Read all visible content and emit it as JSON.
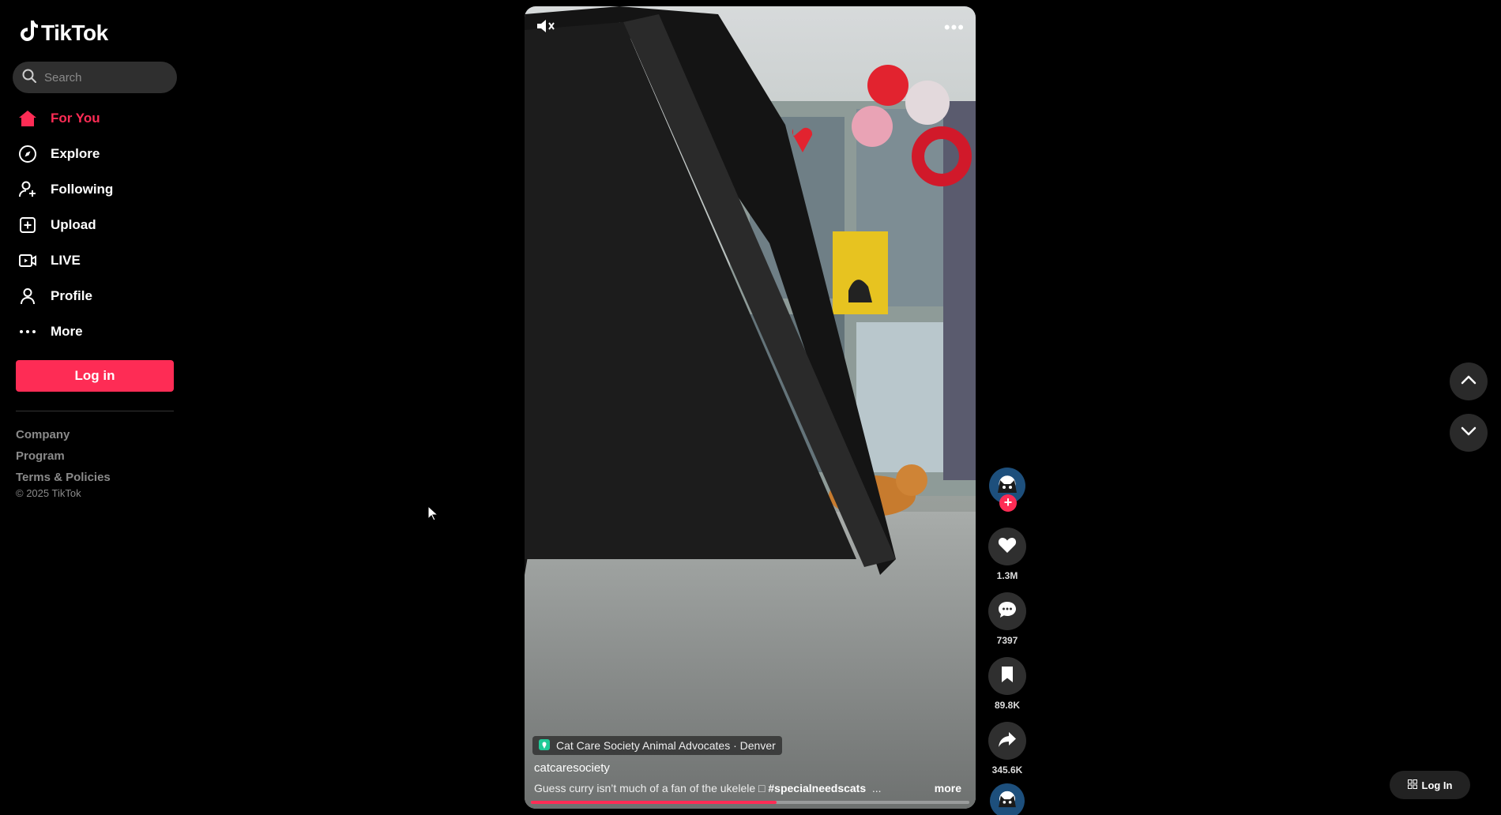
{
  "app": {
    "name": "TikTok"
  },
  "search": {
    "placeholder": "Search"
  },
  "nav": [
    {
      "label": "For You",
      "icon": "home-icon",
      "active": true
    },
    {
      "label": "Explore",
      "icon": "compass-icon"
    },
    {
      "label": "Following",
      "icon": "following-icon"
    },
    {
      "label": "Upload",
      "icon": "upload-icon"
    },
    {
      "label": "LIVE",
      "icon": "live-icon"
    },
    {
      "label": "Profile",
      "icon": "profile-icon"
    },
    {
      "label": "More",
      "icon": "more-icon"
    }
  ],
  "login_button": "Log in",
  "footer": {
    "links": [
      "Company",
      "Program",
      "Terms & Policies"
    ],
    "copyright": "© 2025 TikTok"
  },
  "video": {
    "location": "Cat Care Society Animal Advocates · Denver",
    "username": "catcaresociety",
    "caption_text": "Guess curry isn’t much of a fan of the ukelele □ ",
    "caption_tag": "#specialneedscats",
    "caption_ellipsis": "...",
    "more_label": "more",
    "progress": 0.56
  },
  "actions": {
    "likes": "1.3M",
    "comments": "7397",
    "saves": "89.8K",
    "shares": "345.6K"
  },
  "bottom_button": "Log In",
  "colors": {
    "accent": "#fe2c55",
    "background": "#000000"
  }
}
